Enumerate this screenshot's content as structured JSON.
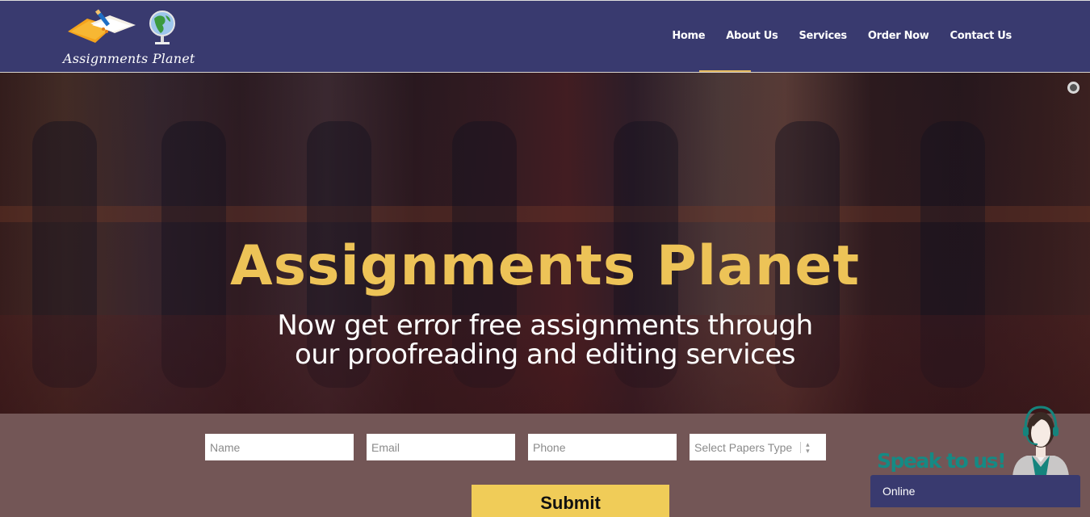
{
  "header": {
    "logo_text": "Assignments Planet",
    "logo_icons": [
      "notebook-pencil-icon",
      "globe-icon"
    ],
    "nav": [
      {
        "label": "Home",
        "active": true
      },
      {
        "label": "About Us",
        "active": false
      },
      {
        "label": "Services",
        "active": false
      },
      {
        "label": "Order Now",
        "active": false
      },
      {
        "label": "Contact Us",
        "active": false
      }
    ],
    "colors": {
      "background": "#393a6f",
      "active_underline": "#e3b85c"
    }
  },
  "hero": {
    "title": "Assignments Planet",
    "subtitle_line1": "Now get error free assignments through",
    "subtitle_line2": "our proofreading and editing services",
    "colors": {
      "title": "#edc357",
      "subtitle": "#ffffff"
    }
  },
  "form": {
    "name_placeholder": "Name",
    "email_placeholder": "Email",
    "phone_placeholder": "Phone",
    "paper_type_selected": "Select Papers Type",
    "submit_label": "Submit",
    "colors": {
      "background": "#735656",
      "submit": "#f0cc58"
    }
  },
  "chat": {
    "speak_text": "Speak to us!",
    "status": "Online",
    "colors": {
      "speak_text": "#158a84",
      "status_bar": "#393a6f"
    }
  }
}
